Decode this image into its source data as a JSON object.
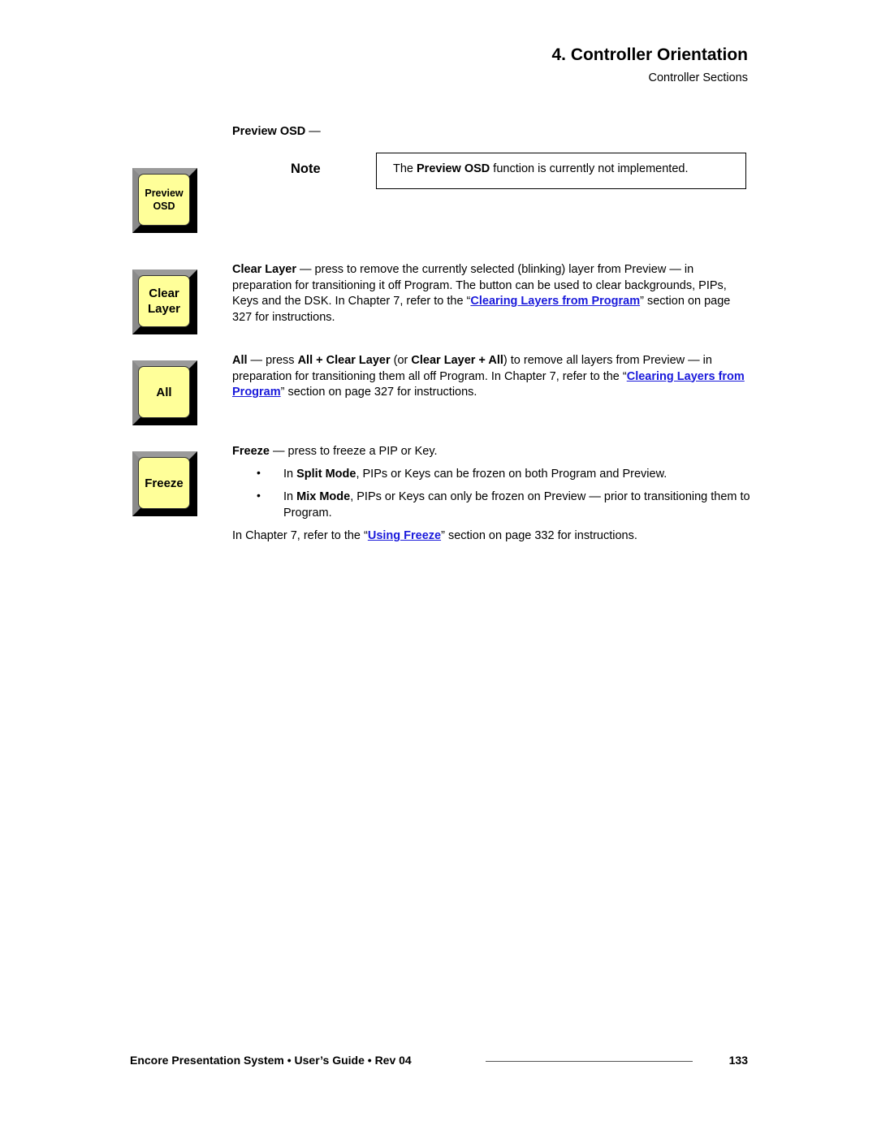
{
  "header": {
    "chapter_title": "4.  Controller Orientation",
    "section_title": "Controller Sections"
  },
  "keys": [
    {
      "id": "preview-osd",
      "line1": "Preview",
      "line2": "OSD"
    },
    {
      "id": "clear-layer",
      "line1": "Clear",
      "line2": "Layer"
    },
    {
      "id": "all",
      "line1": "All"
    },
    {
      "id": "freeze",
      "line1": "Freeze"
    }
  ],
  "preview_osd": {
    "heading": "Preview OSD",
    "heading_suffix": " —",
    "note_label": "Note",
    "note_pre": "The ",
    "note_bold": "Preview OSD",
    "note_post": " function is currently not implemented."
  },
  "clear_layer": {
    "term": "Clear Layer",
    "text1": " — press to remove the currently selected (blinking) layer from Preview — in preparation for transitioning it off Program.  The button can be used to clear backgrounds, PIPs, Keys and the DSK.  In Chapter 7, refer to the “",
    "link": "Clearing Layers from Program",
    "text2": "” section on page 327 for instructions."
  },
  "all": {
    "term": "All",
    "t1": " — press ",
    "b1": "All + Clear Layer",
    "t2": " (or ",
    "b2": "Clear Layer + All",
    "t3": ") to remove all layers from Preview — in preparation for transitioning them all off Program.  In Chapter 7, refer to the “",
    "link": "Clearing Layers from Program",
    "t4": "” section on page 327 for instructions."
  },
  "freeze": {
    "term": "Freeze",
    "text": " — press to freeze a PIP or Key.",
    "bullets": [
      {
        "pre": "In ",
        "bold": "Split Mode",
        "post": ", PIPs or Keys can be frozen on both Program and Preview."
      },
      {
        "pre": "In ",
        "bold": "Mix Mode",
        "post": ", PIPs or Keys can only be frozen on Preview — prior to transitioning them to Program."
      }
    ],
    "bullet_glyph": "•",
    "ref_pre": "In Chapter 7, refer to the “",
    "ref_link": "Using Freeze",
    "ref_post": "” section on page 332 for instructions."
  },
  "footer": {
    "text": "Encore Presentation System  •  User’s Guide  •  Rev 04",
    "page_number": "133"
  }
}
